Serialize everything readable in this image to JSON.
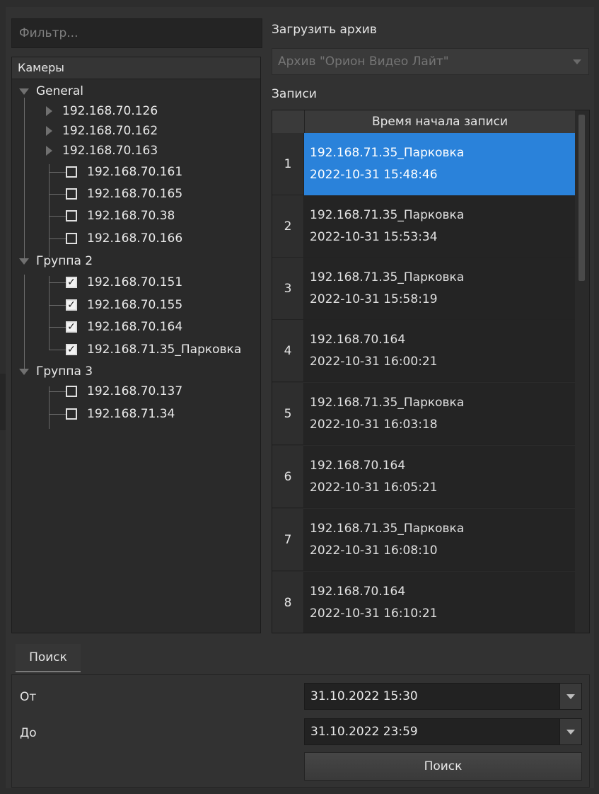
{
  "filter": {
    "placeholder": "Фильтр..."
  },
  "tree": {
    "header": "Камеры",
    "groups": [
      {
        "name": "General"
      },
      {
        "name": "Группа 2"
      },
      {
        "name": "Группа 3"
      }
    ],
    "items": [
      {
        "label": "192.168.70.126",
        "kind": "subgroup"
      },
      {
        "label": "192.168.70.162",
        "kind": "subgroup"
      },
      {
        "label": "192.168.70.163",
        "kind": "subgroup"
      },
      {
        "label": "192.168.70.161",
        "checked": false
      },
      {
        "label": "192.168.70.165",
        "checked": false
      },
      {
        "label": "192.168.70.38",
        "checked": false
      },
      {
        "label": "192.168.70.166",
        "checked": false
      },
      {
        "label": "192.168.70.151",
        "checked": true
      },
      {
        "label": "192.168.70.155",
        "checked": true
      },
      {
        "label": "192.168.70.164",
        "checked": true
      },
      {
        "label": "192.168.71.35_Парковка",
        "checked": true
      },
      {
        "label": "192.168.70.137",
        "checked": false
      },
      {
        "label": "192.168.71.34",
        "checked": false
      }
    ]
  },
  "archive": {
    "label": "Загрузить архив",
    "selected": "Архив \"Орион Видео Лайт\""
  },
  "records": {
    "label": "Записи",
    "column_header": "Время начала записи",
    "rows": [
      {
        "num": "1",
        "name": "192.168.71.35_Парковка",
        "time": "2022-10-31 15:48:46"
      },
      {
        "num": "2",
        "name": "192.168.71.35_Парковка",
        "time": "2022-10-31 15:53:34"
      },
      {
        "num": "3",
        "name": "192.168.71.35_Парковка",
        "time": "2022-10-31 15:58:19"
      },
      {
        "num": "4",
        "name": "192.168.70.164",
        "time": "2022-10-31 16:00:21"
      },
      {
        "num": "5",
        "name": "192.168.71.35_Парковка",
        "time": "2022-10-31 16:03:18"
      },
      {
        "num": "6",
        "name": "192.168.70.164",
        "time": "2022-10-31 16:05:21"
      },
      {
        "num": "7",
        "name": "192.168.71.35_Парковка",
        "time": "2022-10-31 16:08:10"
      },
      {
        "num": "8",
        "name": "192.168.70.164",
        "time": "2022-10-31 16:10:21"
      }
    ],
    "selected_color": "#2a82da"
  },
  "search": {
    "tab": "Поиск",
    "from_label": "От",
    "from_value": "31.10.2022 15:30",
    "to_label": "До",
    "to_value": "31.10.2022 23:59",
    "button": "Поиск"
  }
}
